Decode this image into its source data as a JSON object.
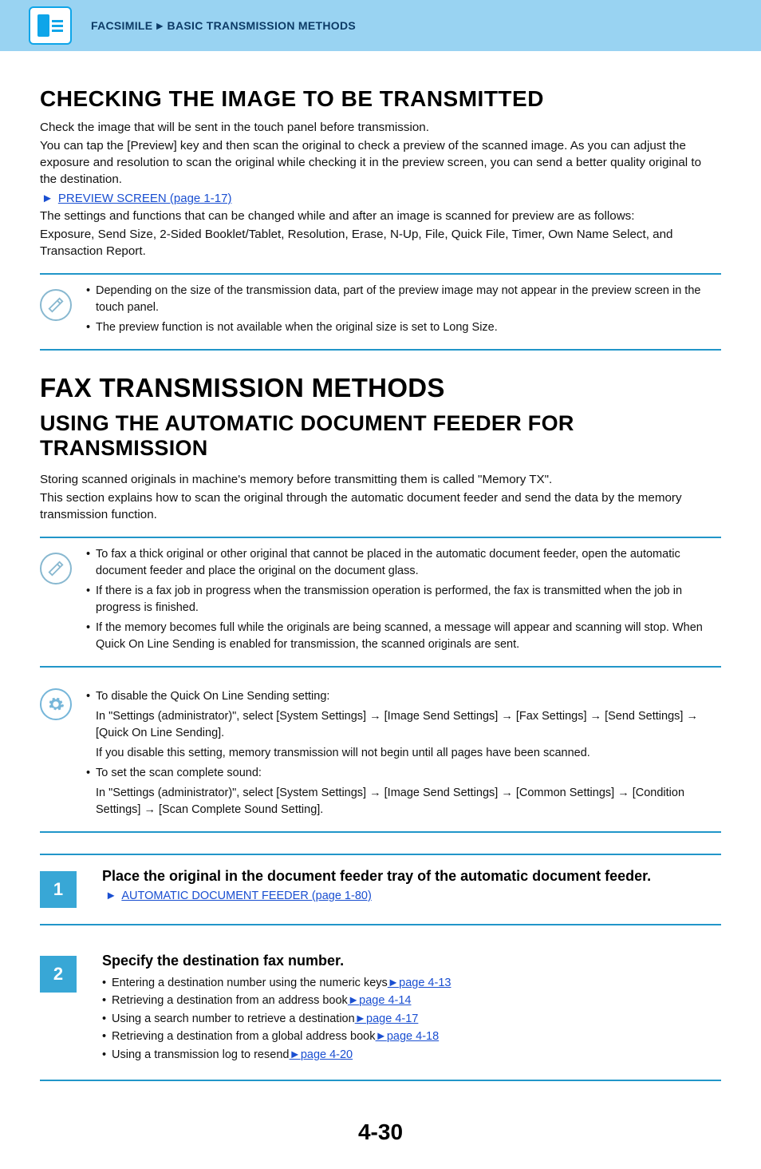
{
  "breadcrumb": {
    "section": "FACSIMILE",
    "subsection": "BASIC TRANSMISSION METHODS",
    "arrow": "►"
  },
  "h_check_title": "CHECKING THE IMAGE TO BE TRANSMITTED",
  "check_p1": "Check the image that will be sent in the touch panel before transmission.",
  "check_p2": "You can tap the [Preview] key and then scan the original to check a preview of the scanned image. As you can adjust the exposure and resolution to scan the original while checking it in the preview screen, you can send a better quality original to the destination.",
  "link_preview": "PREVIEW SCREEN (page 1-17)",
  "check_p3": "The settings and functions that can be changed while and after an image is scanned for preview are as follows:",
  "check_p4": "Exposure, Send Size, 2-Sided Booklet/Tablet, Resolution, Erase, N-Up, File, Quick File, Timer, Own Name Select, and Transaction Report.",
  "note1_b1": "Depending on the size of the transmission data, part of the preview image may not appear in the preview screen in the touch panel.",
  "note1_b2": "The preview function is not available when the original size is set to Long Size.",
  "h_fax_methods": "FAX TRANSMISSION METHODS",
  "h_adf": "USING THE AUTOMATIC DOCUMENT FEEDER FOR TRANSMISSION",
  "adf_p1": "Storing scanned originals in machine's memory before transmitting them is called \"Memory TX\".",
  "adf_p2": "This section explains how to scan the original through the automatic document feeder and send the data by the memory transmission function.",
  "note2_b1": "To fax a thick original or other original that cannot be placed in the automatic document feeder, open the automatic document feeder and place the original on the document glass.",
  "note2_b2": "If there is a fax job in progress when the transmission operation is performed, the fax is transmitted when the job in progress is finished.",
  "note2_b3": "If the memory becomes full while the originals are being scanned, a message will appear and scanning will stop. When Quick On Line Sending is enabled for transmission, the scanned originals are sent.",
  "note3_b1": "To disable the Quick On Line Sending setting:",
  "note3_b1_s1": "In \"Settings (administrator)\", select [System Settings] → [Image Send Settings] → [Fax Settings] → [Send Settings] → [Quick On Line Sending].",
  "note3_b1_s2": "If you disable this setting, memory transmission will not begin until all pages have been scanned.",
  "note3_b2": "To set the scan complete sound:",
  "note3_b2_s1": "In \"Settings (administrator)\", select [System Settings] → [Image Send Settings] → [Common Settings] → [Condition Settings] → [Scan Complete Sound Setting].",
  "steps": {
    "s1": {
      "num": "1",
      "title": "Place the original in the document feeder tray of the automatic document feeder.",
      "link": "AUTOMATIC DOCUMENT FEEDER (page 1-80)"
    },
    "s2": {
      "num": "2",
      "title": "Specify the destination fax number.",
      "items": [
        {
          "text": "Entering a destination number using the numeric keys",
          "link": "page 4-13"
        },
        {
          "text": "Retrieving a destination from an address book",
          "link": "page 4-14"
        },
        {
          "text": "Using a search number to retrieve a destination",
          "link": "page 4-17"
        },
        {
          "text": "Retrieving a destination from a global address book",
          "link": "page 4-18"
        },
        {
          "text": "Using a transmission log to resend",
          "link": "page 4-20"
        }
      ]
    }
  },
  "page_number": "4-30"
}
